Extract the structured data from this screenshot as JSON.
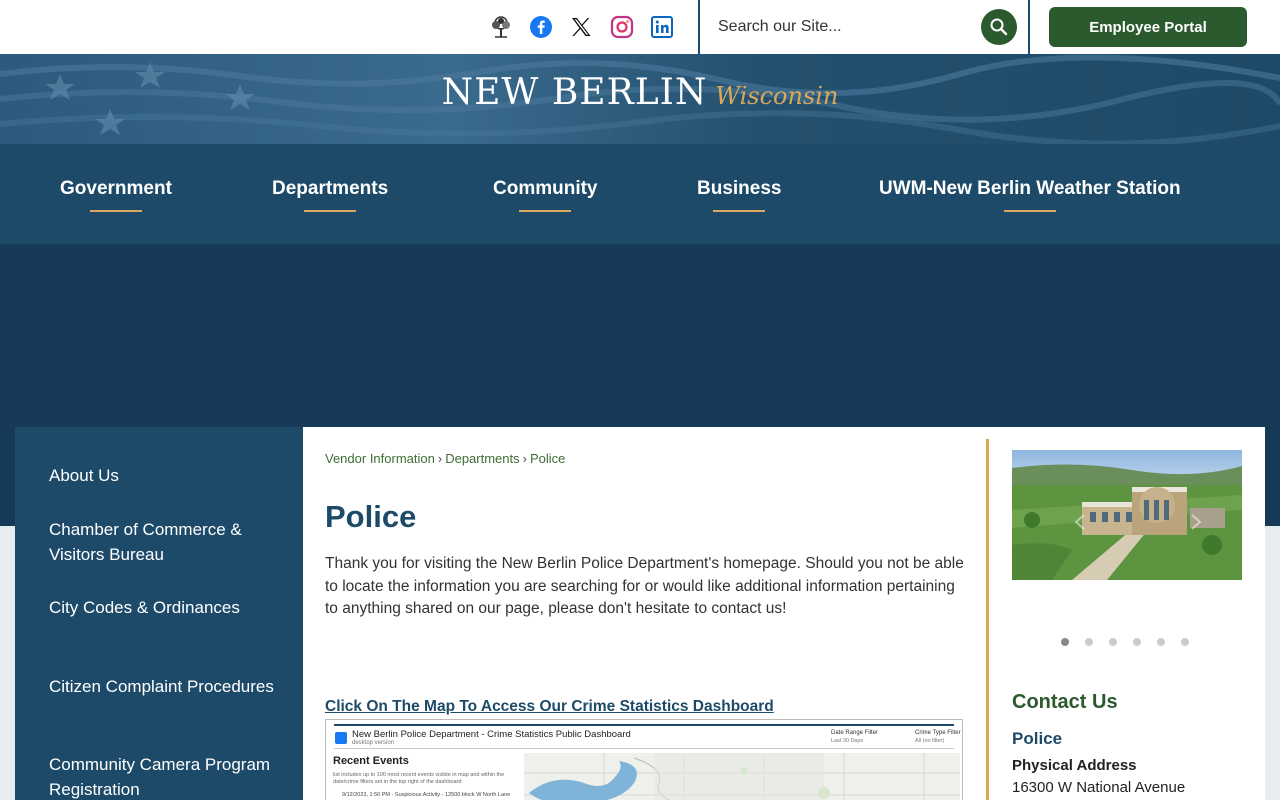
{
  "topbar": {
    "social": [
      {
        "name": "tree-logo-icon"
      },
      {
        "name": "facebook-icon"
      },
      {
        "name": "x-twitter-icon"
      },
      {
        "name": "instagram-icon"
      },
      {
        "name": "linkedin-icon"
      }
    ],
    "search_placeholder": "Search our Site...",
    "employee_portal": "Employee Portal"
  },
  "header": {
    "logo_main": "NEW BERLIN",
    "logo_sub": "Wisconsin",
    "nav": [
      "Government",
      "Departments",
      "Community",
      "Business",
      "UWM-New Berlin Weather Station"
    ]
  },
  "sidebar": {
    "items": [
      "About Us",
      "Chamber of Commerce & Visitors Bureau",
      "City Codes & Ordinances",
      "Citizen Complaint Procedures",
      "Community Camera Program Registration"
    ]
  },
  "main": {
    "breadcrumbs": [
      "Vendor Information",
      "Departments",
      "Police"
    ],
    "title": "Police",
    "intro": "Thank you for visiting the New Berlin Police Department's homepage. Should you not be able to locate the information you are searching for or would like additional information pertaining to anything shared on our page, please don't hesitate to contact us!",
    "map_link": "Click On The Map To Access Our Crime Statistics Dashboard",
    "dashboard": {
      "title": "New Berlin Police Department - Crime Statistics Public Dashboard",
      "subtitle": "desktop version",
      "filter1": "Date Range Filter",
      "filter1_val": "Last 30 Days",
      "filter2": "Crime Type Filter",
      "filter2_val": "All (no filter)",
      "section": "Recent Events",
      "note": "list includes up to 100 most recent events visible in map and within the date/crime filters set in the top right of the dashboard",
      "event": "9/12/2023, 1:50 PM - Suspicious Activity - 12500 block W North Lane"
    }
  },
  "right": {
    "carousel_count": 6,
    "carousel_active": 0,
    "contact_heading": "Contact Us",
    "contact_dept": "Police",
    "address_label": "Physical Address",
    "address": "16300 W National Avenue"
  },
  "colors": {
    "navy": "#1d4a68",
    "green": "#2a5a2e",
    "gold": "#d9a85a"
  }
}
